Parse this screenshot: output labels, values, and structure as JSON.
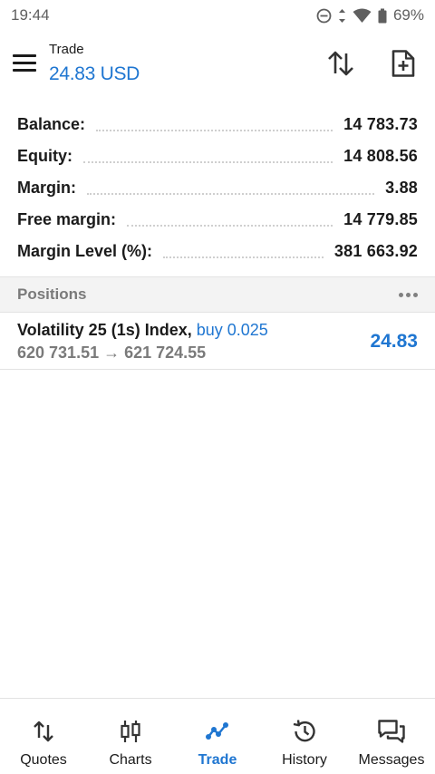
{
  "status_bar": {
    "time": "19:44",
    "battery": "69%"
  },
  "header": {
    "title": "Trade",
    "subtitle": "24.83 USD"
  },
  "summary": [
    {
      "label": "Balance:",
      "value": "14 783.73"
    },
    {
      "label": "Equity:",
      "value": "14 808.56"
    },
    {
      "label": "Margin:",
      "value": "3.88"
    },
    {
      "label": "Free margin:",
      "value": "14 779.85"
    },
    {
      "label": "Margin Level (%):",
      "value": "381 663.92"
    }
  ],
  "positions": {
    "title": "Positions",
    "items": [
      {
        "symbol": "Volatility 25 (1s) Index,",
        "side": "buy 0.025",
        "prices": "620 731.51 → 621 724.55",
        "profit": "24.83"
      }
    ]
  },
  "nav": [
    {
      "label": "Quotes",
      "icon": "quotes-icon"
    },
    {
      "label": "Charts",
      "icon": "charts-icon"
    },
    {
      "label": "Trade",
      "icon": "trade-icon",
      "active": true
    },
    {
      "label": "History",
      "icon": "history-icon"
    },
    {
      "label": "Messages",
      "icon": "messages-icon"
    }
  ],
  "colors": {
    "accent": "#1f76d1",
    "text": "#1b1b1b",
    "muted": "#7a7a7a"
  }
}
